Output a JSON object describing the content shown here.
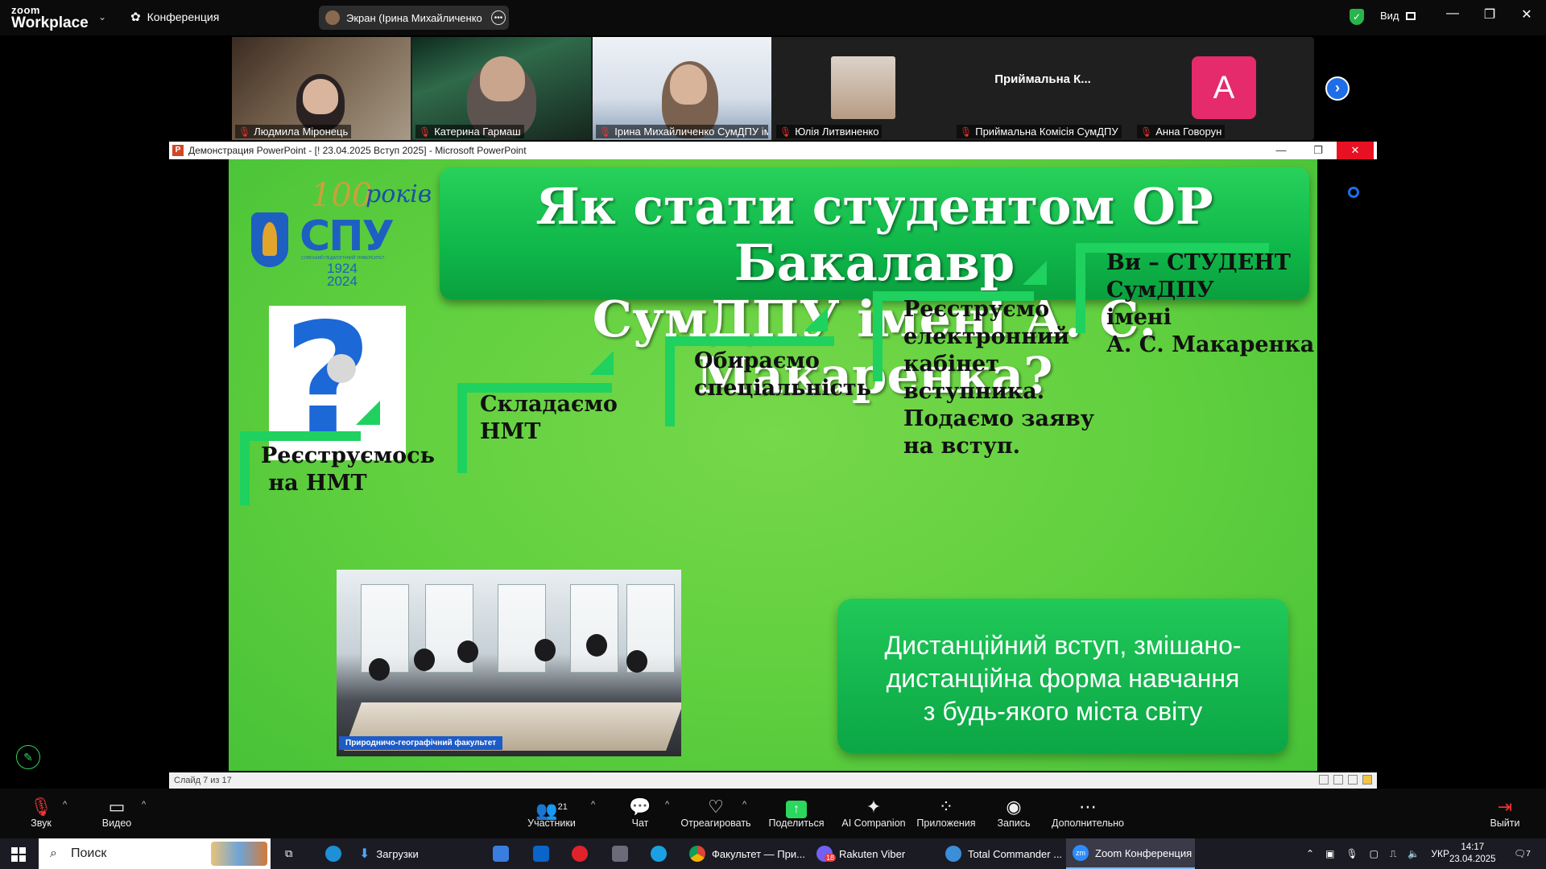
{
  "app": {
    "logo_line1": "zoom",
    "logo_line2": "Workplace",
    "meeting_menu": "Конференция",
    "share_tab": "Экран (Ірина Михайличенко Су",
    "view_label": "Вид"
  },
  "participants": [
    {
      "name": "Людмила Міронець",
      "muted": true
    },
    {
      "name": "Катерина Гармаш",
      "muted": true
    },
    {
      "name": "Ірина Михайличенко СумДПУ імен...",
      "muted": true,
      "active": true
    },
    {
      "name": "Юлія Литвиненко",
      "muted": true
    },
    {
      "name": "Приймальна Комісія СумДПУ",
      "muted": true,
      "tile_text": "Приймальна  К..."
    },
    {
      "name": "Анна Говорун",
      "muted": true,
      "avatar": "A"
    }
  ],
  "ppt": {
    "window_title": "Демонстрация PowerPoint - [! 23.04.2025 Вступ 2025] - Microsoft PowerPoint",
    "status": "Слайд 7 из 17"
  },
  "slide": {
    "logo_100": "100",
    "logo_rokiv": "років",
    "logo_spu": "СПУ",
    "logo_sub": "СУМСЬКИЙ ПЕДАГОГІЧНИЙ УНІВЕРСИТЕТ",
    "logo_year1": "1924",
    "logo_year2": "2024",
    "title_line1": "Як стати студентом ОР Бакалавр",
    "title_line2": "СумДПУ імені А. С. Макаренка?",
    "steps": [
      {
        "lines": [
          "Реєструємось",
          " на НМТ"
        ]
      },
      {
        "lines": [
          "Складаємо",
          "НМТ"
        ]
      },
      {
        "lines": [
          "Обираємо",
          "спеціальність"
        ]
      },
      {
        "lines": [
          "Реєструємо",
          "електронний",
          "кабінет",
          "вступника.",
          "Подаємо заяву",
          "на вступ."
        ]
      },
      {
        "lines": [
          "Ви – СТУДЕНТ",
          "СумДПУ",
          "імені",
          "А. С. Макаренка"
        ]
      }
    ],
    "photo_caption": "Природничо-географічний факультет",
    "distance_lines": [
      "Дистанційний вступ, змішано-",
      "дистанційна форма навчання",
      "з будь-якого міста світу"
    ]
  },
  "toolbar": {
    "audio": "Звук",
    "video": "Видео",
    "participants": "Участники",
    "participants_count": "21",
    "chat": "Чат",
    "react": "Отреагировать",
    "share": "Поделиться",
    "ai": "AI Companion",
    "apps": "Приложения",
    "record": "Запись",
    "more": "Дополнительно",
    "leave": "Выйти"
  },
  "taskbar": {
    "search": "Поиск",
    "downloads": "Загрузки",
    "chrome": "Факультет — При...",
    "viber": "Rakuten Viber",
    "viber_badge": "18",
    "tc": "Total Commander ...",
    "zoom": "Zoom Конференция",
    "lang": "УКР",
    "time": "14:17",
    "date": "23.04.2025",
    "notif": "7"
  },
  "colors": {
    "slide_green": "#5fcf3e",
    "box_green": "#0fb84a",
    "active_green": "#2bd75c",
    "zoom_blue": "#1f6ee8",
    "avatar_pink": "#e52b6c"
  }
}
